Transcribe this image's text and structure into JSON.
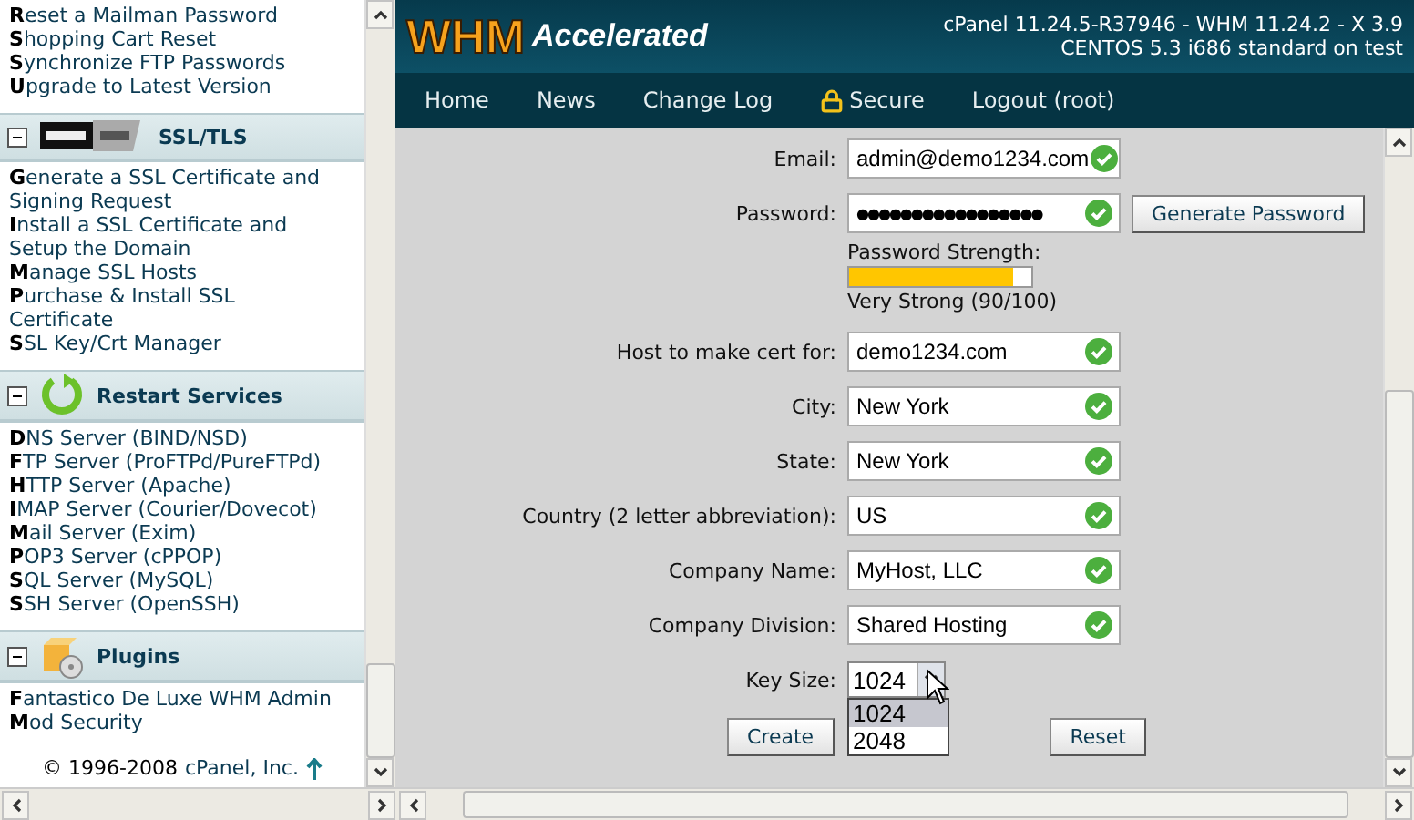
{
  "sidebar": {
    "sections": [
      {
        "expanded": true,
        "items": [
          "**R**eset a Mailman Password",
          "**S**hopping Cart Reset",
          "**S**ynchronize FTP Passwords",
          "**U**pgrade to Latest Version"
        ]
      },
      {
        "title": "SSL/TLS",
        "expanded": true,
        "items": [
          "**G**enerate a SSL Certificate and Signing Request",
          "**I**nstall a SSL Certificate and Setup the Domain",
          "**M**anage SSL Hosts",
          "**P**urchase & Install SSL Certificate",
          "**S**SL Key/Crt Manager"
        ]
      },
      {
        "title": "Restart Services",
        "expanded": true,
        "items": [
          "**D**NS Server (BIND/NSD)",
          "**F**TP Server (ProFTPd/PureFTPd)",
          "**H**TTP Server (Apache)",
          "**I**MAP Server (Courier/Dovecot)",
          "**M**ail Server (Exim)",
          "**P**OP3 Server (cPPOP)",
          "**S**QL Server (MySQL)",
          "**S**SH Server (OpenSSH)"
        ]
      },
      {
        "title": "Plugins",
        "expanded": true,
        "items": [
          "**F**antastico De Luxe WHM Admin",
          "**M**od Security"
        ]
      }
    ],
    "footer": {
      "text": "© 1996-2008",
      "link": "cPanel, Inc."
    }
  },
  "header": {
    "logo_main": "WHM",
    "logo_sub": "Accelerated",
    "version_lines": [
      "cPanel 11.24.5-R37946 - WHM 11.24.2 - X 3.9",
      "CENTOS 5.3 i686 standard on test"
    ]
  },
  "nav": [
    {
      "label": "Home",
      "kind": "plain"
    },
    {
      "label": "News",
      "kind": "plain"
    },
    {
      "label": "Change Log",
      "kind": "plain"
    },
    {
      "label": "Secure",
      "kind": "lock"
    },
    {
      "label": "Logout (root)",
      "kind": "plain"
    }
  ],
  "form": {
    "email": {
      "label": "Email:",
      "value": "admin@demo1234.com",
      "valid": true
    },
    "password": {
      "label": "Password:",
      "value": "●●●●●●●●●●●●●●●●●",
      "valid": true,
      "button": "Generate Password"
    },
    "strength": {
      "label": "Password Strength:",
      "level": 0.9,
      "reading": "Very Strong (90/100)"
    },
    "fields": [
      {
        "label": "Host to make cert for:",
        "value": "demo1234.com",
        "valid": true
      },
      {
        "label": "City:",
        "value": "New York",
        "valid": true
      },
      {
        "label": "State:",
        "value": "New York",
        "valid": true
      },
      {
        "label": "Country (2 letter abbreviation):",
        "value": "US",
        "valid": true
      },
      {
        "label": "Company Name:",
        "value": "MyHost, LLC",
        "valid": true
      },
      {
        "label": "Company Division:",
        "value": "Shared Hosting",
        "valid": true
      }
    ],
    "key_size": {
      "label": "Key Size:",
      "value": "1024",
      "expanded": true,
      "options": [
        {
          "label": "1024",
          "selected": true
        },
        {
          "label": "2048",
          "selected": false
        }
      ]
    },
    "buttons": [
      "Create",
      "Reset"
    ]
  }
}
